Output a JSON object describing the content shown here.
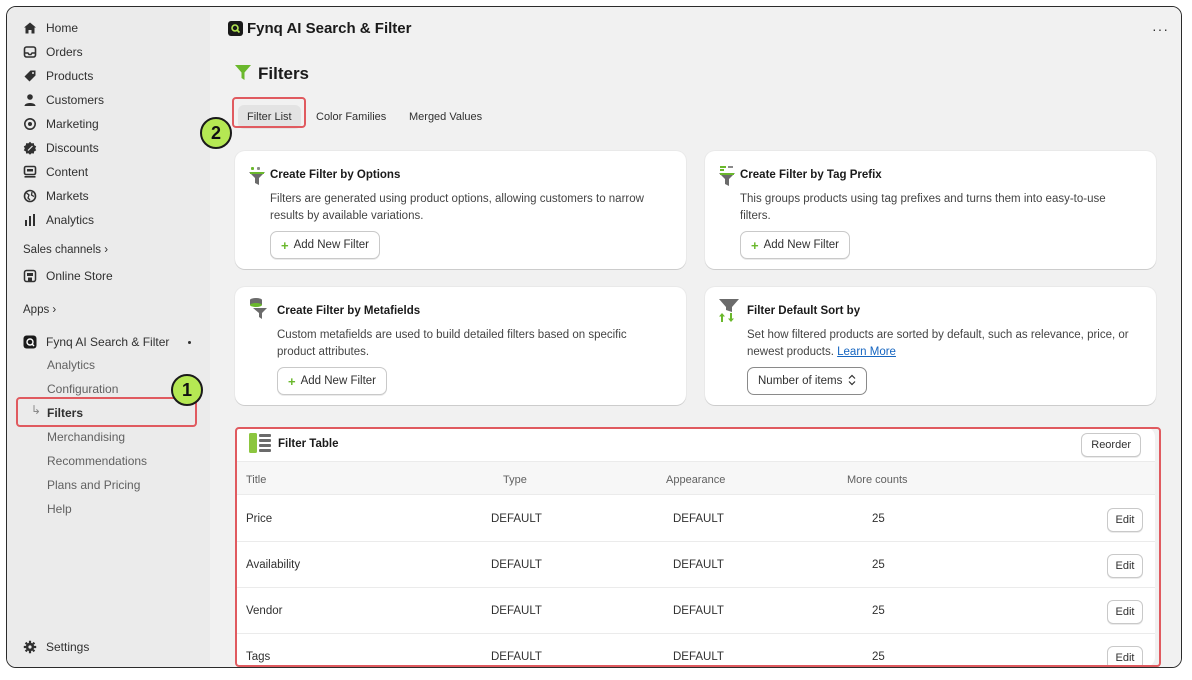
{
  "sidebar": {
    "items": [
      {
        "label": "Home",
        "icon": "home-icon"
      },
      {
        "label": "Orders",
        "icon": "orders-icon"
      },
      {
        "label": "Products",
        "icon": "tag-icon"
      },
      {
        "label": "Customers",
        "icon": "person-icon"
      },
      {
        "label": "Marketing",
        "icon": "target-icon"
      },
      {
        "label": "Discounts",
        "icon": "discount-icon"
      },
      {
        "label": "Content",
        "icon": "content-icon"
      },
      {
        "label": "Markets",
        "icon": "globe-icon"
      },
      {
        "label": "Analytics",
        "icon": "bar-chart-icon"
      }
    ],
    "sales_channels_label": "Sales channels",
    "online_store_label": "Online Store",
    "apps_label": "Apps",
    "app_name": "Fynq AI Search & Filter",
    "app_sub_items": [
      "Analytics",
      "Configuration",
      "Filters",
      "Merchandising",
      "Recommendations",
      "Plans and Pricing",
      "Help"
    ],
    "settings_label": "Settings"
  },
  "topbar": {
    "title": "Fynq AI Search & Filter",
    "more": "···"
  },
  "page": {
    "title": "Filters"
  },
  "tabs": [
    "Filter List",
    "Color Families",
    "Merged Values"
  ],
  "cards": {
    "options": {
      "title": "Create Filter by Options",
      "desc1": "Filters are generated using product options, allowing customers to narrow",
      "desc2": "results by available variations.",
      "button": "Add New Filter"
    },
    "tag_prefix": {
      "title": "Create Filter by Tag Prefix",
      "desc1": "This groups products using tag prefixes and turns them into easy-to-use",
      "desc2": "filters.",
      "button": "Add New Filter"
    },
    "metafields": {
      "title": "Create Filter by Metafields",
      "desc1": "Custom metafields are used to build detailed filters based on specific",
      "desc2": "product attributes.",
      "button": "Add New Filter"
    },
    "default_sort": {
      "title": "Filter Default Sort by",
      "desc1": "Set how filtered products are sorted by default, such as relevance, price, or",
      "desc2": "newest products.",
      "link": "Learn More",
      "select_value": "Number of items"
    }
  },
  "filter_table": {
    "title": "Filter Table",
    "reorder": "Reorder",
    "columns": [
      "Title",
      "Type",
      "Appearance",
      "More counts"
    ],
    "rows": [
      {
        "title": "Price",
        "type": "DEFAULT",
        "appearance": "DEFAULT",
        "count": "25"
      },
      {
        "title": "Availability",
        "type": "DEFAULT",
        "appearance": "DEFAULT",
        "count": "25"
      },
      {
        "title": "Vendor",
        "type": "DEFAULT",
        "appearance": "DEFAULT",
        "count": "25"
      },
      {
        "title": "Tags",
        "type": "DEFAULT",
        "appearance": "DEFAULT",
        "count": "25"
      }
    ],
    "edit": "Edit"
  },
  "annotations": {
    "badge1": "1",
    "badge2": "2"
  },
  "colors": {
    "accent_green": "#b5e853",
    "annotation_red": "#e05a5f",
    "link": "#1565c0"
  }
}
